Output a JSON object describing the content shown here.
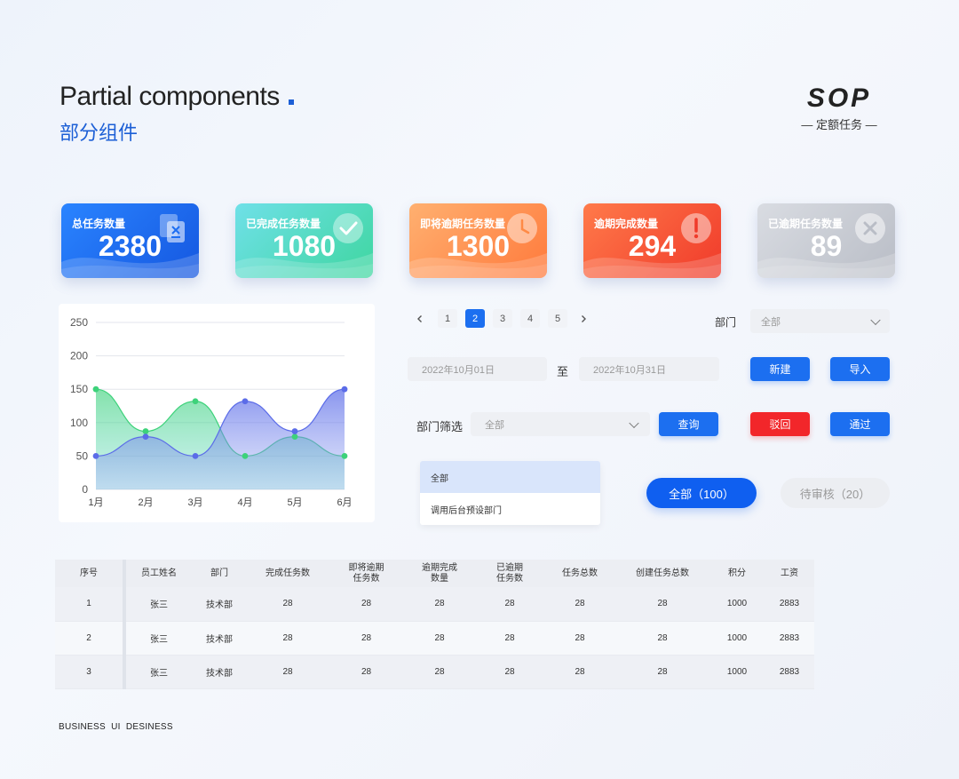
{
  "header": {
    "title_en": "Partial components",
    "title_cn": "部分组件",
    "brand": "SOP",
    "brand_sub": "— 定额任务 —"
  },
  "stat_cards": [
    {
      "label": "总任务数量",
      "value": "2380",
      "icon": "document-icon",
      "color": "#1d6ef2"
    },
    {
      "label": "已完成任务数量",
      "value": "1080",
      "icon": "check-circle-icon",
      "color": "#4ed6c0"
    },
    {
      "label": "即将逾期任务数量",
      "value": "1300",
      "icon": "clock-icon",
      "color": "#ff8a45"
    },
    {
      "label": "逾期完成数量",
      "value": "294",
      "icon": "exclamation-circle-icon",
      "color": "#f4482d"
    },
    {
      "label": "已逾期任务数量",
      "value": "89",
      "icon": "x-circle-icon",
      "color": "#c2c6cf"
    }
  ],
  "chart_data": {
    "type": "area",
    "categories": [
      "1月",
      "2月",
      "3月",
      "4月",
      "5月",
      "6月"
    ],
    "y_ticks": [
      "0",
      "50",
      "100",
      "150",
      "200",
      "250"
    ],
    "ylim": [
      0,
      250
    ],
    "series": [
      {
        "values": [
          150,
          87,
          132,
          50,
          79,
          50
        ],
        "color": "#3dd27a"
      },
      {
        "values": [
          50,
          79,
          50,
          132,
          87,
          150
        ],
        "color": "#5b6ce8"
      }
    ]
  },
  "pagination": {
    "prev_icon": "chevron-left-icon",
    "next_icon": "chevron-right-icon",
    "pages": [
      "1",
      "2",
      "3",
      "4",
      "5"
    ],
    "active": "2"
  },
  "dept_filter": {
    "label": "部门",
    "value": "全部"
  },
  "date_range": {
    "start": "2022年10月01日",
    "separator": "至",
    "end": "2022年10月31日"
  },
  "buttons": {
    "new": "新建",
    "import": "导入",
    "query": "查询",
    "reject": "驳回",
    "approve": "通过"
  },
  "dept_select": {
    "label": "部门筛选",
    "value": "全部"
  },
  "dropdown": {
    "options": [
      "全部",
      "调用后台预设部门"
    ]
  },
  "pills": {
    "all": "全部（100）",
    "pending": "待审核（20）"
  },
  "table": {
    "headers": [
      "序号",
      "员工姓名",
      "部门",
      "完成任务数",
      "即将逾期\n任务数",
      "逾期完成\n数量",
      "已逾期\n任务数",
      "任务总数",
      "创建任务总数",
      "积分",
      "工资"
    ],
    "rows": [
      [
        "1",
        "张三",
        "技术部",
        "28",
        "28",
        "28",
        "28",
        "28",
        "28",
        "1000",
        "2883"
      ],
      [
        "2",
        "张三",
        "技术部",
        "28",
        "28",
        "28",
        "28",
        "28",
        "28",
        "1000",
        "2883"
      ],
      [
        "3",
        "张三",
        "技术部",
        "28",
        "28",
        "28",
        "28",
        "28",
        "28",
        "1000",
        "2883"
      ]
    ]
  },
  "footer": "BUSINESS  UI  DESINESS"
}
